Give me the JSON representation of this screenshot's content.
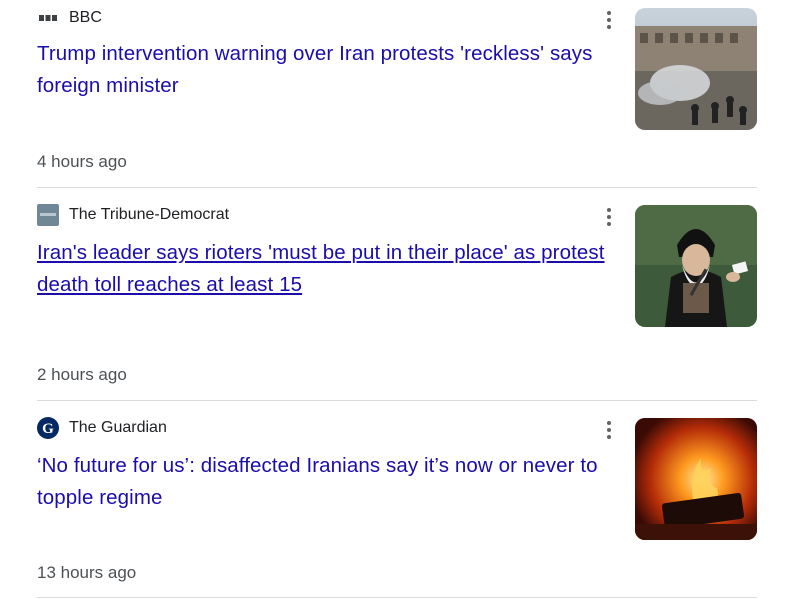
{
  "articles": [
    {
      "source": "BBC",
      "source_icon": "bbc-logo-icon",
      "headline": "Trump intervention warning over Iran protests 'reckless' says foreign minister",
      "time": "4 hours ago",
      "thumbnail": "street-protest-smoke-image"
    },
    {
      "source": "The Tribune-Democrat",
      "source_icon": "tribune-democrat-logo-icon",
      "headline": "Iran's leader says rioters 'must be put in their place' as protest death toll reaches at least 15",
      "time": "2 hours ago",
      "thumbnail": "cleric-speaking-image"
    },
    {
      "source": "The Guardian",
      "source_icon": "guardian-logo-icon",
      "headline": "‘No future for us’: disaffected Iranians say it’s now or never to topple regime",
      "time": "13 hours ago",
      "thumbnail": "burning-vehicle-image"
    }
  ],
  "colors": {
    "link": "#1a0dab",
    "meta": "#4d5156",
    "divider": "#dadce0"
  }
}
